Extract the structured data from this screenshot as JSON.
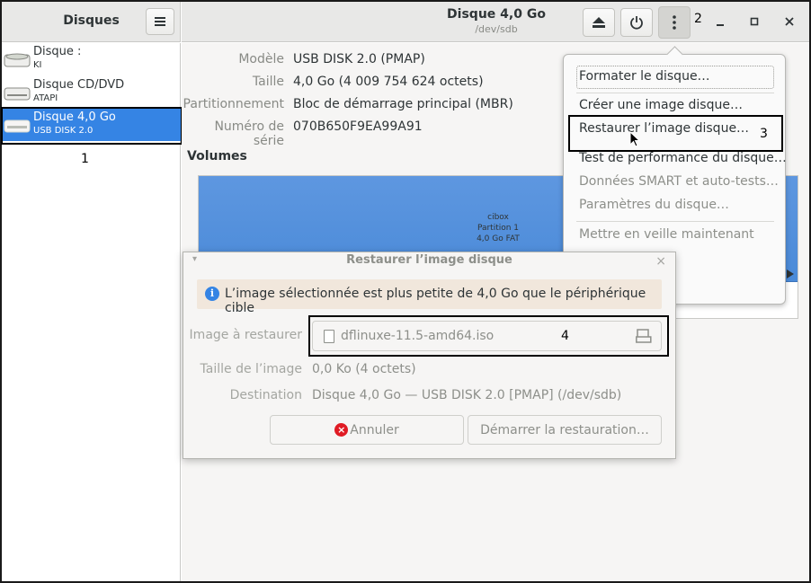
{
  "sidebar": {
    "title": "Disques",
    "items": [
      {
        "name": "Disque :",
        "sub": "KI"
      },
      {
        "name": "Disque CD/DVD",
        "sub": "ATAPI"
      },
      {
        "name": "Disque 4,0 Go",
        "sub": "USB DISK 2.0",
        "selected": true
      }
    ]
  },
  "header": {
    "title": "Disque 4,0 Go",
    "subtitle": "/dev/sdb"
  },
  "details": [
    {
      "label": "Modèle",
      "value": "USB DISK 2.0 (PMAP)"
    },
    {
      "label": "Taille",
      "value": "4,0 Go (4 009 754 624 octets)"
    },
    {
      "label": "Partitionnement",
      "value": "Bloc de démarrage principal (MBR)"
    },
    {
      "label": "Numéro de série",
      "value": "070B650F9EA99A91"
    }
  ],
  "volumes": {
    "title": "Volumes",
    "partition": {
      "line1": "cibox",
      "line2": "Partition 1",
      "line3": "4,0 Go FAT"
    }
  },
  "menu": {
    "items": [
      {
        "label": "Formater le disque…",
        "enabled": true
      },
      {
        "label": "Créer une image disque…",
        "enabled": true
      },
      {
        "label": "Restaurer l’image disque…",
        "enabled": true
      },
      {
        "label": "Test de performance du disque…",
        "enabled": true
      },
      {
        "label": "Données SMART et auto-tests…",
        "enabled": false
      },
      {
        "label": "Paramètres du disque…",
        "enabled": false
      },
      {
        "label": "Mettre en veille maintenant",
        "enabled": false
      }
    ]
  },
  "dialog": {
    "title": "Restaurer l’image disque",
    "info": "L’image sélectionnée est plus petite de 4,0 Go que le périphérique cible",
    "image_label": "Image à restaurer",
    "image_file": "dflinuxe-11.5-amd64.iso",
    "size_label": "Taille de l’image",
    "size_value": "0,0 Ko (4 octets)",
    "dest_label": "Destination",
    "dest_value": "Disque 4,0 Go — USB DISK 2.0 [PMAP] (/dev/sdb)",
    "cancel_label": "Annuler",
    "start_label": "Démarrer la restauration…"
  },
  "annotations": {
    "a1": "1",
    "a2": "2",
    "a3": "3",
    "a4": "4"
  },
  "colors": {
    "accent": "#3584e4",
    "partition": "#4a8ad8",
    "info_bar": "#f1e7dc"
  }
}
